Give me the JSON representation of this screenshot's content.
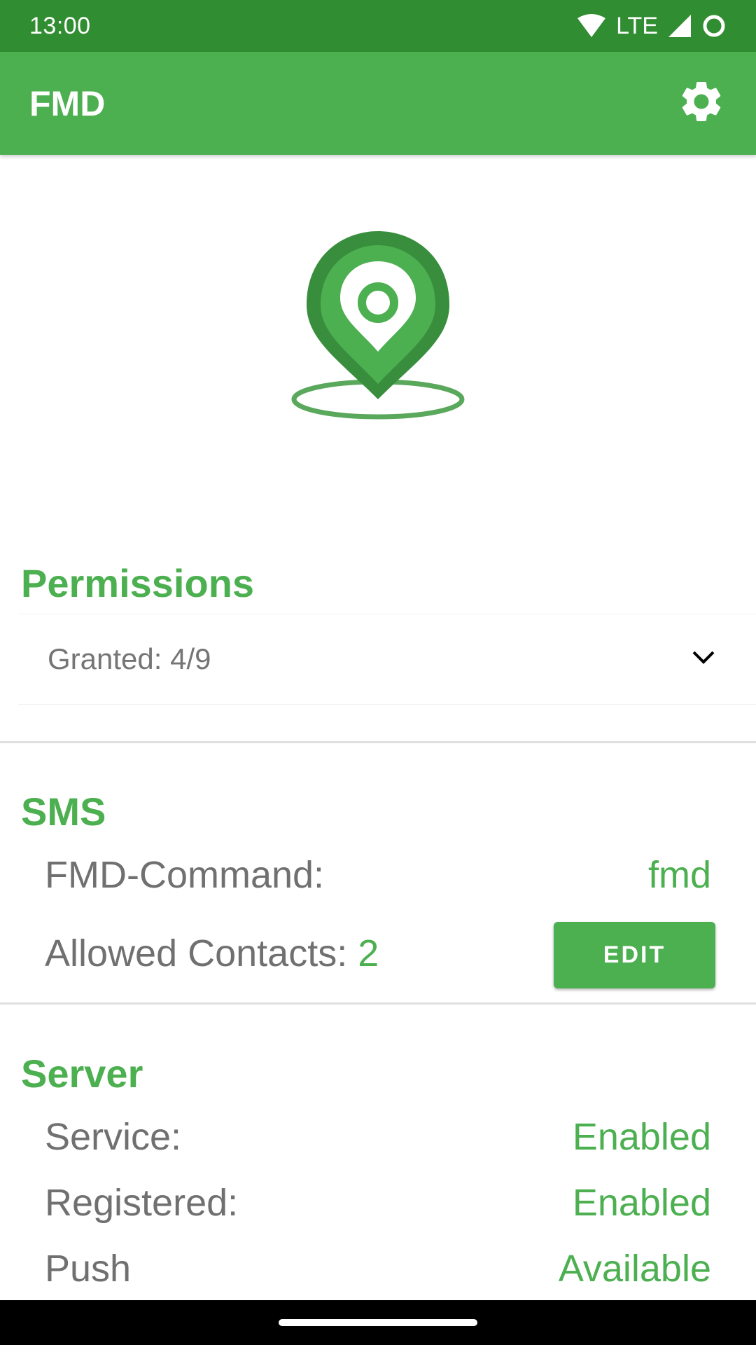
{
  "status_bar": {
    "time": "13:00",
    "network": "LTE"
  },
  "app_bar": {
    "title": "FMD",
    "settings_icon": "gear-icon"
  },
  "logo": {
    "icon": "location-pin-icon",
    "colors": {
      "outer": "#388e3c",
      "inner": "#4caf50",
      "center": "#ffffff"
    }
  },
  "permissions": {
    "title": "Permissions",
    "granted_text": "Granted: 4/9",
    "expand_icon": "chevron-down-icon"
  },
  "sms": {
    "title": "SMS",
    "command_label": "FMD-Command:",
    "command_value": "fmd",
    "contacts_label": "Allowed Contacts: ",
    "contacts_value": "2",
    "edit_label": "EDIT"
  },
  "server": {
    "title": "Server",
    "service_label": "Service:",
    "service_value": "Enabled",
    "registered_label": "Registered:",
    "registered_value": "Enabled",
    "push_label": "Push",
    "push_value": "Available"
  },
  "colors": {
    "primary": "#4caf50",
    "primary_dark": "#318d31",
    "text_secondary": "#757575"
  }
}
